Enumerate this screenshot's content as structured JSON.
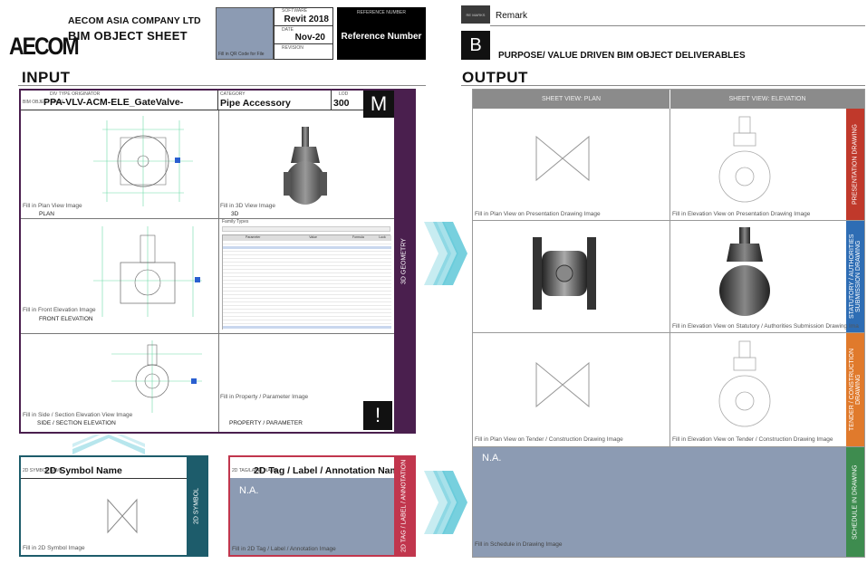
{
  "header": {
    "company": "AECOM ASIA COMPANY LTD",
    "sheet_title": "BIM OBJECT SHEET",
    "logo_text": "AECOM",
    "qr_caption": "Fill in QR Code for File",
    "software_label": "SOFTWARE",
    "software": "Revit 2018",
    "date_label": "DATE",
    "date": "Nov-20",
    "revision_label": "REVISION",
    "ref_label": "REFERENCE NUMBER",
    "ref_value": "Reference Number",
    "remark_tag": "RE MARKS",
    "remark": "Remark",
    "purpose_icon": "B",
    "purpose": "PURPOSE/ VALUE DRIVEN BIM OBJECT DELIVERABLES"
  },
  "input": {
    "title": "INPUT",
    "name_tag": "BIM OBJECT NAME",
    "name_sub": "DIV   TYPE   ORIGINATOR",
    "object_name": "PPA-VLV-ACM-ELE_GateValve-",
    "category_tag": "CATEGORY",
    "category": "Pipe Accessory",
    "lod_tag": "LOD",
    "lod": "300",
    "model_icon": "M",
    "side_label": "3D GEOMETRY",
    "plan_caption": "Fill in Plan View Image",
    "plan_label": "PLAN",
    "view3d_caption": "Fill in 3D View Image",
    "view3d_label": "3D",
    "front_caption": "Fill in Front Elevation Image",
    "front_label": "FRONT ELEVATION",
    "side_caption": "Fill in Side / Section Elevation View Image",
    "side_section_label": "SIDE / SECTION ELEVATION",
    "prop_caption": "Fill in Property / Parameter Image",
    "prop_label": "PROPERTY / PARAMETER",
    "prop_icon": "!",
    "prop_table_title": "Family Types",
    "prop_table_headers": [
      "Parameter",
      "Value",
      "Formula",
      "Lock"
    ]
  },
  "symbol": {
    "tag": "2D SYMBOL NAME",
    "name": "2D Symbol Name",
    "caption": "Fill in 2D Symbol Image",
    "side_label": "2D SYMBOL"
  },
  "annotation": {
    "tag": "2D TAG/LABEL NAME",
    "name": "2D Tag / Label / Annotation Name",
    "na": "N.A.",
    "caption": "Fill in 2D Tag / Label / Annotation Image",
    "side_label": "2D TAG / LABEL / ANNOTATION"
  },
  "output": {
    "title": "OUTPUT",
    "col_plan": "SHEET VIEW: PLAN",
    "col_elev": "SHEET VIEW: ELEVATION",
    "rows": [
      {
        "plan_caption": "Fill in Plan View on Presentation Drawing Image",
        "elev_caption": "Fill in Elevation View on Presentation Drawing Image",
        "side": "PRESENTATION DRAWING",
        "color": "#c0392b"
      },
      {
        "plan_caption": "",
        "elev_caption": "Fill in Elevation View on Statutory / Authorities Submission Drawing Ima",
        "side": "STATUTORY / AUTHORITIES SUBMISSION DRAWING",
        "color": "#2e6db4"
      },
      {
        "plan_caption": "Fill in Plan View on Tender / Construction Drawing Image",
        "elev_caption": "Fill in Elevation View on Tender / Construction Drawing Image",
        "side": "TENDER / CONSTRUCTION DRAWING",
        "color": "#e07a2c"
      },
      {
        "na": "N.A.",
        "caption": "Fill in Schedule in Drawing Image",
        "side": "SCHEDULE IN DRAWING",
        "color": "#3e8c4f"
      }
    ]
  },
  "colors": {
    "input_frame": "#4a1f4e",
    "symbol_side": "#1d5c6b",
    "annotation_side": "#c1364d",
    "arrow": "#5fc8d8"
  }
}
